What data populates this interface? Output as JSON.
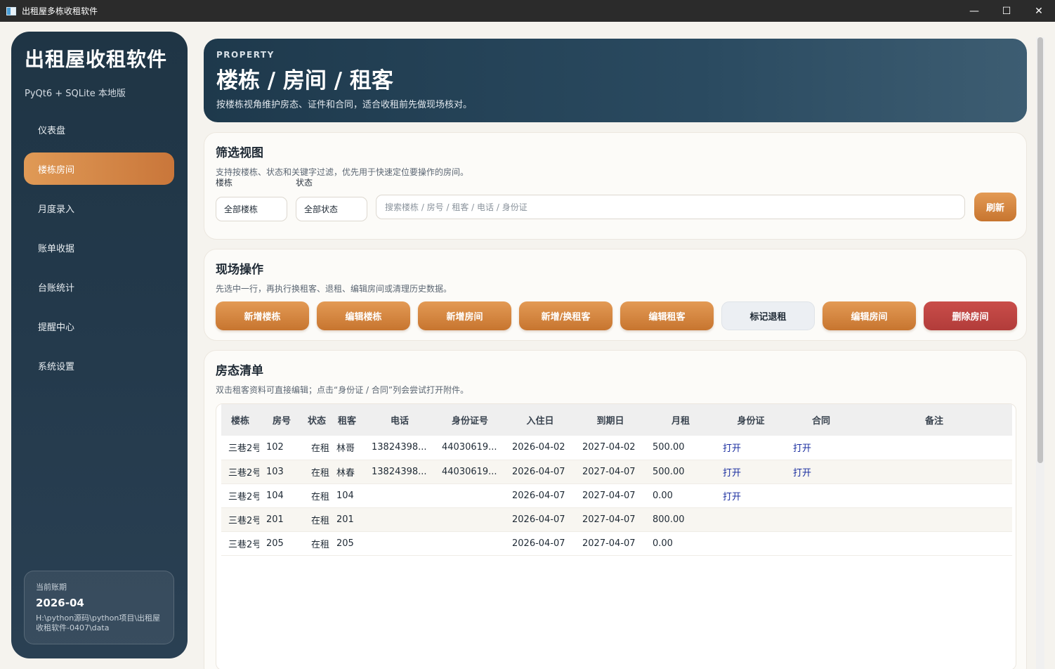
{
  "window": {
    "title": "出租屋多栋收租软件",
    "controls": {
      "minimize": "—",
      "maximize": "☐",
      "close": "✕"
    }
  },
  "sidebar": {
    "brand": "出租屋收租软件",
    "subtitle": "PyQt6 + SQLite 本地版",
    "items": [
      {
        "label": "仪表盘",
        "active": false
      },
      {
        "label": "楼栋房间",
        "active": true
      },
      {
        "label": "月度录入",
        "active": false
      },
      {
        "label": "账单收据",
        "active": false
      },
      {
        "label": "台账统计",
        "active": false
      },
      {
        "label": "提醒中心",
        "active": false
      },
      {
        "label": "系统设置",
        "active": false
      }
    ],
    "period": {
      "label": "当前账期",
      "value": "2026-04",
      "path": "H:\\python源码\\python项目\\出租屋收租软件-0407\\data"
    }
  },
  "hero": {
    "eyebrow": "PROPERTY",
    "title": "楼栋 / 房间 / 租客",
    "description": "按楼栋视角维护房态、证件和合同，适合收租前先做现场核对。"
  },
  "filter": {
    "title": "筛选视图",
    "description": "支持按楼栋、状态和关键字过滤，优先用于快速定位要操作的房间。",
    "building_label": "楼栋",
    "building_value": "全部楼栋",
    "status_label": "状态",
    "status_value": "全部状态",
    "search_placeholder": "搜索楼栋 / 房号 / 租客 / 电话 / 身份证",
    "refresh_label": "刷新"
  },
  "operations": {
    "title": "现场操作",
    "description": "先选中一行，再执行换租客、退租、编辑房间或清理历史数据。",
    "buttons": [
      "新增楼栋",
      "编辑楼栋",
      "新增房间",
      "新增/换租客",
      "编辑租客",
      "标记退租",
      "编辑房间",
      "删除房间"
    ]
  },
  "room_list": {
    "title": "房态清单",
    "description": "双击租客资料可直接编辑；点击“身份证 / 合同”列会尝试打开附件。",
    "columns": [
      "楼栋",
      "房号",
      "状态",
      "租客",
      "电话",
      "身份证号",
      "入住日",
      "到期日",
      "月租",
      "身份证",
      "合同",
      "备注"
    ],
    "rows": [
      [
        "三巷2号",
        "102",
        "在租",
        "林哥",
        "13824398...",
        "44030619...",
        "2026-04-02",
        "2027-04-02",
        "500.00",
        "打开",
        "打开",
        ""
      ],
      [
        "三巷2号",
        "103",
        "在租",
        "林春",
        "13824398...",
        "44030619...",
        "2026-04-07",
        "2027-04-07",
        "500.00",
        "打开",
        "打开",
        ""
      ],
      [
        "三巷2号",
        "104",
        "在租",
        "104",
        "",
        "",
        "2026-04-07",
        "2027-04-07",
        "0.00",
        "打开",
        "",
        ""
      ],
      [
        "三巷2号",
        "201",
        "在租",
        "201",
        "",
        "",
        "2026-04-07",
        "2027-04-07",
        "800.00",
        "",
        "",
        ""
      ],
      [
        "三巷2号",
        "205",
        "在租",
        "205",
        "",
        "",
        "2026-04-07",
        "2027-04-07",
        "0.00",
        "",
        "",
        ""
      ]
    ]
  },
  "colors": {
    "accent": "#d4884a",
    "sidebar": "#1f3545",
    "danger": "#c04644",
    "link": "#1a2ea0"
  }
}
